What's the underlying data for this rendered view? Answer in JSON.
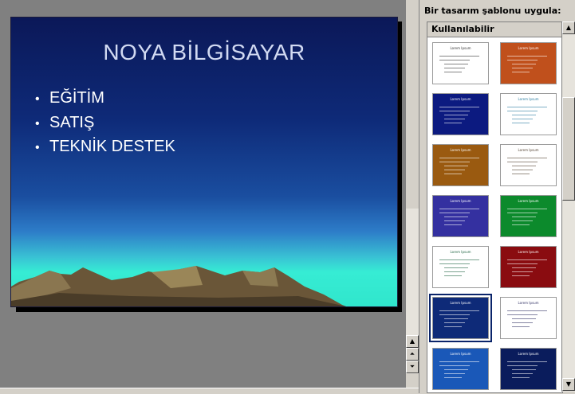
{
  "slide": {
    "title": "NOYA BİLGİSAYAR",
    "bullets": [
      "EĞİTİM",
      "SATIŞ",
      "TEKNİK DESTEK"
    ]
  },
  "pane": {
    "heading": "Bir tasarım şablonu uygula:",
    "section_label": "Kullanılabilir",
    "thumb_title": "Lorem Ipsum",
    "thumbnails": [
      {
        "name": "plain-white",
        "bg": "#ffffff",
        "fg": "#333333"
      },
      {
        "name": "orange-brown",
        "bg": "#c0501c",
        "fg": "#ffffff"
      },
      {
        "name": "navy-stripe",
        "bg": "#0c1a80",
        "fg": "#ffffff"
      },
      {
        "name": "white-teal",
        "bg": "#ffffff",
        "fg": "#2a7ca0"
      },
      {
        "name": "brown-gold",
        "bg": "#9a5a10",
        "fg": "#ffffff"
      },
      {
        "name": "white-swirl",
        "bg": "#ffffff",
        "fg": "#554433"
      },
      {
        "name": "purple-blue",
        "bg": "#3430a0",
        "fg": "#ffffff"
      },
      {
        "name": "green",
        "bg": "#0c8a2c",
        "fg": "#ffffff"
      },
      {
        "name": "white-green",
        "bg": "#ffffff",
        "fg": "#226644"
      },
      {
        "name": "dark-red",
        "bg": "#8a0c10",
        "fg": "#ffffff"
      },
      {
        "name": "mountain-navy",
        "bg": "#0e2a78",
        "fg": "#ffffff"
      },
      {
        "name": "white-rounded",
        "bg": "#ffffff",
        "fg": "#333366"
      },
      {
        "name": "blue-wave",
        "bg": "#1a58b8",
        "fg": "#ffffff"
      },
      {
        "name": "deep-navy",
        "bg": "#0a1c5c",
        "fg": "#ffffff"
      }
    ]
  },
  "colors": {
    "selection": "#0a246a",
    "pane_bg": "#d4d0c8",
    "workspace": "#808080"
  }
}
